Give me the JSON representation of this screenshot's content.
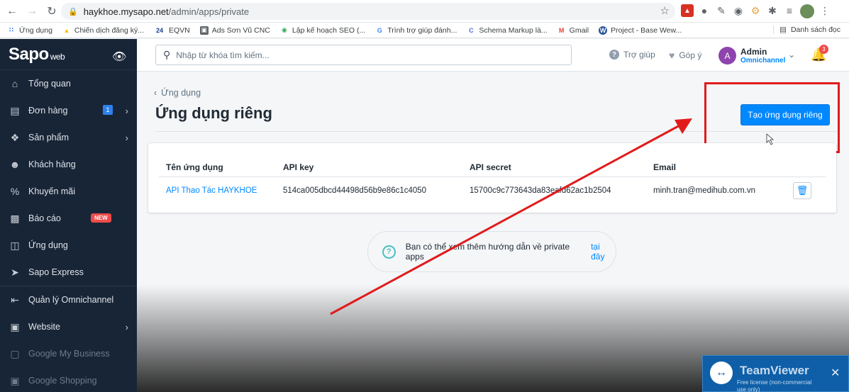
{
  "browser": {
    "url_host": "haykhoe.mysapo.net",
    "url_path": "/admin/apps/private",
    "bookmarks": [
      {
        "label": "Ứng dụng",
        "icon": "apps-grid-icon",
        "color": "#4285f4"
      },
      {
        "label": "Chiến dịch đăng ký...",
        "icon": "google-ads-icon",
        "color": "#fbbc04"
      },
      {
        "label": "EQVN",
        "icon": "24h-icon",
        "color": "#1a3d8f"
      },
      {
        "label": "Ads Sơn Vũ CNC",
        "icon": "doc-icon",
        "color": "#5f6368"
      },
      {
        "label": "Lập kế hoạch SEO (...",
        "icon": "circle-icon",
        "color": "#34a853"
      },
      {
        "label": "Trình trợ giúp đánh...",
        "icon": "google-icon",
        "color": "#4285f4"
      },
      {
        "label": "Schema Markup là...",
        "icon": "c-icon",
        "color": "#4b6fd8"
      },
      {
        "label": "Gmail",
        "icon": "gmail-icon",
        "color": "#ea4335"
      },
      {
        "label": "Project - Base Wew...",
        "icon": "w-icon",
        "color": "#2b579a"
      }
    ],
    "reading_list": "Danh sách đọc"
  },
  "sidebar": {
    "logo": "Sapo",
    "logo_sub": "web",
    "items": [
      {
        "label": "Tổng quan",
        "icon": "home-icon"
      },
      {
        "label": "Đơn hàng",
        "icon": "orders-icon",
        "badge": "1",
        "chevron": true
      },
      {
        "label": "Sản phẩm",
        "icon": "products-icon",
        "chevron": true
      },
      {
        "label": "Khách hàng",
        "icon": "customer-icon"
      },
      {
        "label": "Khuyến mãi",
        "icon": "promotion-icon"
      },
      {
        "label": "Báo cáo",
        "icon": "report-icon",
        "tag": "NEW"
      },
      {
        "label": "Ứng dụng",
        "icon": "apps-icon"
      },
      {
        "label": "Sapo Express",
        "icon": "express-icon"
      },
      {
        "label": "Quản lý Omnichannel",
        "icon": "omnichannel-icon"
      },
      {
        "label": "Website",
        "icon": "website-icon",
        "chevron": true
      },
      {
        "label": "Google My Business",
        "icon": "gmb-icon"
      },
      {
        "label": "Google Shopping",
        "icon": "shopping-icon"
      }
    ]
  },
  "header": {
    "search_placeholder": "Nhập từ khóa tìm kiếm...",
    "help": "Trợ giúp",
    "feedback": "Góp ý",
    "user_initial": "A",
    "user_name": "Admin",
    "user_role": "Omnichannel",
    "notifications": "3"
  },
  "page": {
    "breadcrumb": "Ứng dụng",
    "title": "Ứng dụng riêng",
    "create_button": "Tạo ứng dụng riêng",
    "table": {
      "headers": [
        "Tên ứng dụng",
        "API key",
        "API secret",
        "Email"
      ],
      "rows": [
        {
          "name": "API Thao Tác HAYKHOE",
          "api_key": "514ca005dbcd44498d56b9e86c1c4050",
          "api_secret": "15700c9c773643da83eafd62ac1b2504",
          "email": "minh.tran@medihub.com.vn"
        }
      ]
    },
    "help_text": "Bạn có thể xem thêm hướng dẫn về private apps",
    "help_link": "tại đây"
  },
  "teamviewer": {
    "title": "TeamViewer",
    "line1": "Free license (non-commercial",
    "line2": "use only)"
  },
  "colors": {
    "sidebar_bg": "#182537",
    "primary": "#0088ff",
    "highlight": "#e11b1b",
    "badge_new": "#ef4b4b"
  }
}
